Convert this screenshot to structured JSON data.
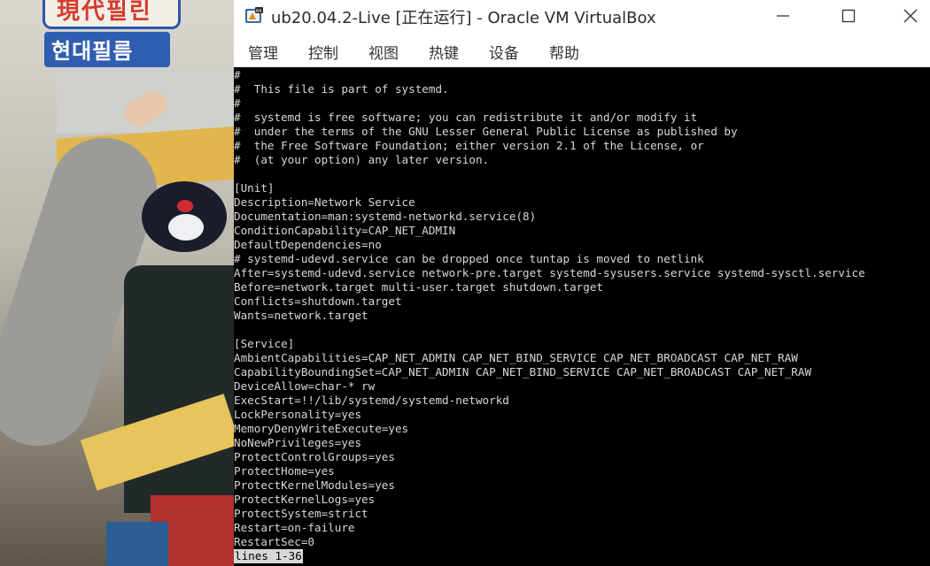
{
  "window": {
    "title": "ub20.04.2-Live [正在运行] - Oracle VM VirtualBox"
  },
  "menu": {
    "items": [
      "管理",
      "控制",
      "视图",
      "热键",
      "设备",
      "帮助"
    ]
  },
  "terminal": {
    "lines": [
      "#",
      "#  This file is part of systemd.",
      "#",
      "#  systemd is free software; you can redistribute it and/or modify it",
      "#  under the terms of the GNU Lesser General Public License as published by",
      "#  the Free Software Foundation; either version 2.1 of the License, or",
      "#  (at your option) any later version.",
      "",
      "[Unit]",
      "Description=Network Service",
      "Documentation=man:systemd-networkd.service(8)",
      "ConditionCapability=CAP_NET_ADMIN",
      "DefaultDependencies=no",
      "# systemd-udevd.service can be dropped once tuntap is moved to netlink",
      "After=systemd-udevd.service network-pre.target systemd-sysusers.service systemd-sysctl.service",
      "Before=network.target multi-user.target shutdown.target",
      "Conflicts=shutdown.target",
      "Wants=network.target",
      "",
      "[Service]",
      "AmbientCapabilities=CAP_NET_ADMIN CAP_NET_BIND_SERVICE CAP_NET_BROADCAST CAP_NET_RAW",
      "CapabilityBoundingSet=CAP_NET_ADMIN CAP_NET_BIND_SERVICE CAP_NET_BROADCAST CAP_NET_RAW",
      "DeviceAllow=char-* rw",
      "ExecStart=!!/lib/systemd/systemd-networkd",
      "LockPersonality=yes",
      "MemoryDenyWriteExecute=yes",
      "NoNewPrivileges=yes",
      "ProtectControlGroups=yes",
      "ProtectHome=yes",
      "ProtectKernelModules=yes",
      "ProtectKernelLogs=yes",
      "ProtectSystem=strict",
      "Restart=on-failure",
      "RestartSec=0"
    ],
    "status": "lines 1-36"
  },
  "background": {
    "sign_text": "현대필름",
    "sign_top_text": "現代필린"
  },
  "colors": {
    "terminal_bg": "#000000",
    "terminal_fg": "#d8d8d8",
    "titlebar_bg": "#ffffff"
  }
}
